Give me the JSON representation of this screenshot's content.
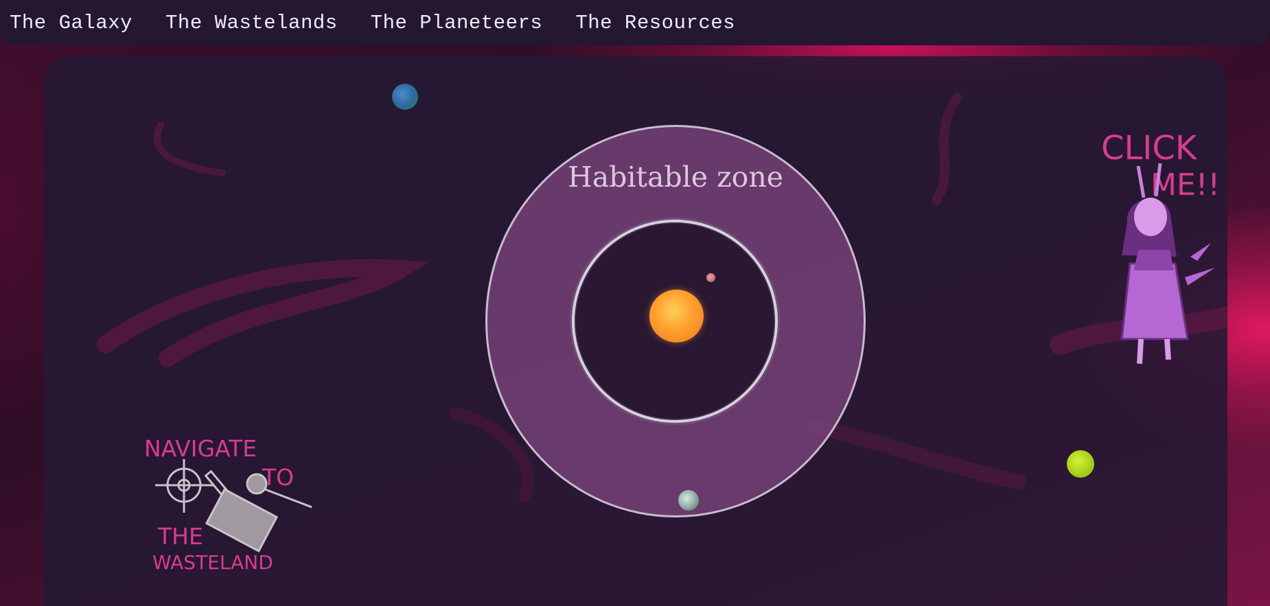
{
  "nav": {
    "links": [
      "The Galaxy",
      "The Wastelands",
      "The Planeteers",
      "The Resources"
    ]
  },
  "system": {
    "zone_label": "Habitable zone"
  },
  "doodles": {
    "navigate": [
      "NAVIGATE",
      "TO",
      "THE",
      "WASTELAND"
    ],
    "click": [
      "CLICK",
      "ME!!"
    ]
  },
  "colors": {
    "nav_bg": "#231732",
    "panel_bg": "#26183a",
    "zone_fill": "#824882",
    "accent_pink": "#d83d8c",
    "star": "#ff9f2e"
  }
}
